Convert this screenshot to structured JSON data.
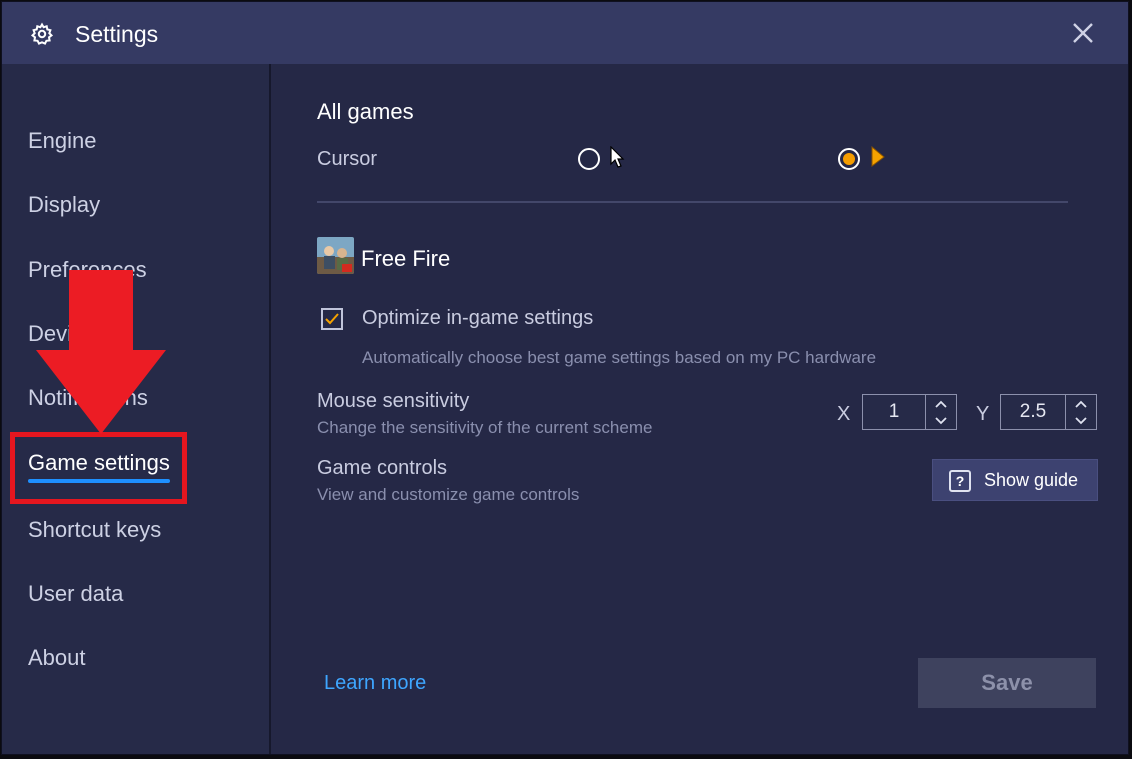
{
  "window": {
    "title": "Settings"
  },
  "sidebar": {
    "items": [
      {
        "label": "Engine"
      },
      {
        "label": "Display"
      },
      {
        "label": "Preferences"
      },
      {
        "label": "Devices"
      },
      {
        "label": "Notifications"
      },
      {
        "label": "Game settings",
        "active": true
      },
      {
        "label": "Shortcut keys"
      },
      {
        "label": "User data"
      },
      {
        "label": "About"
      }
    ]
  },
  "all_games": {
    "title": "All games",
    "cursor_label": "Cursor",
    "cursor_options": [
      {
        "icon": "white-arrow-cursor-icon",
        "selected": false
      },
      {
        "icon": "orange-arrow-cursor-icon",
        "selected": true
      }
    ]
  },
  "game": {
    "name": "Free Fire",
    "icon": "free-fire-game-icon",
    "optimize_label": "Optimize in-game settings",
    "optimize_checked": true,
    "optimize_desc": "Automatically choose best game settings based on my PC hardware",
    "mouse_label": "Mouse sensitivity",
    "mouse_desc": "Change the sensitivity of the current scheme",
    "x_label": "X",
    "x_value": "1",
    "y_label": "Y",
    "y_value": "2.5",
    "controls_label": "Game controls",
    "controls_desc": "View and customize game controls",
    "guide_icon_text": "?",
    "guide_label": "Show guide"
  },
  "footer": {
    "learn_more": "Learn more",
    "save": "Save"
  },
  "colors": {
    "accent": "#1e90ff",
    "highlight": "#e5161f",
    "radio_selected": "#f59d00",
    "link": "#3ea6ff"
  }
}
